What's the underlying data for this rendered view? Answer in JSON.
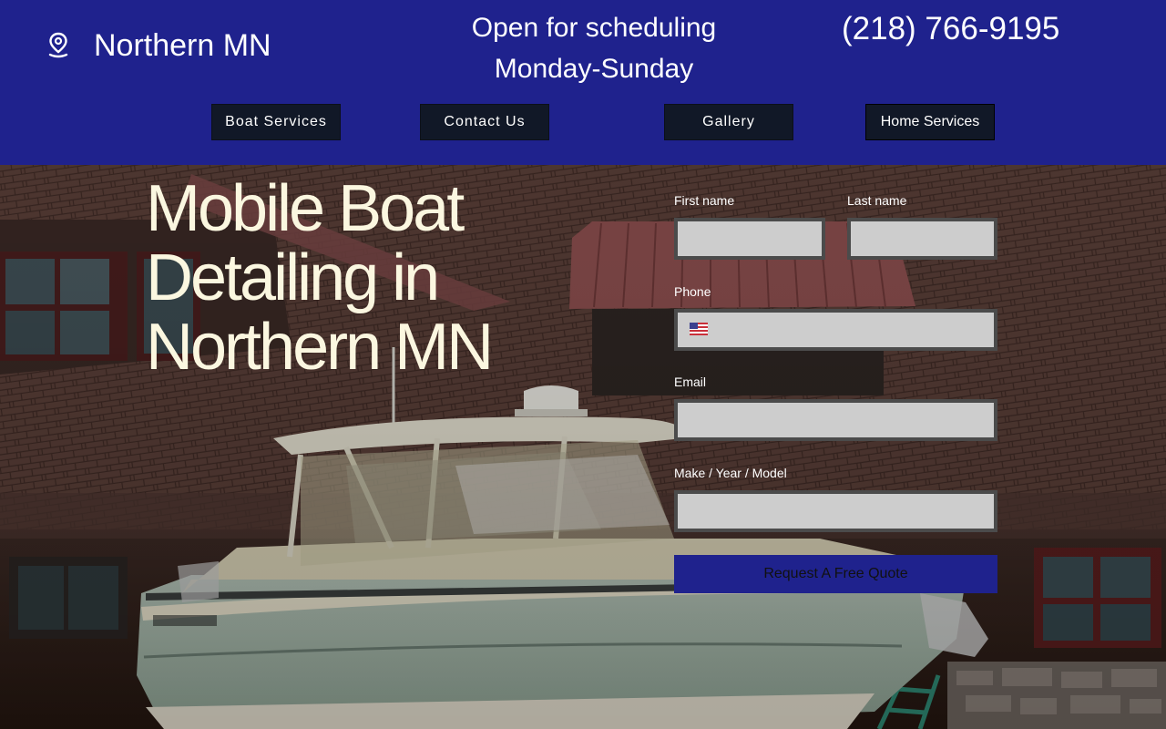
{
  "header": {
    "location": "Northern MN",
    "schedule_line1": "Open for scheduling",
    "schedule_line2": "Monday-Sunday",
    "phone": "(218) 766-9195",
    "location_icon": "map-pin-icon",
    "background_color": "#1f228d"
  },
  "nav": {
    "items": [
      {
        "label": "Boat Services"
      },
      {
        "label": "Contact Us"
      },
      {
        "label": "Gallery"
      },
      {
        "label": "Home Services"
      }
    ],
    "button_color": "#111827"
  },
  "hero": {
    "title": "Mobile Boat Detailing in Northern MN",
    "title_color": "#fbf7e0"
  },
  "form": {
    "first_name_label": "First name",
    "last_name_label": "Last name",
    "phone_label": "Phone",
    "email_label": "Email",
    "vehicle_label": "Make / Year / Model",
    "first_name_value": "",
    "last_name_value": "",
    "phone_value": "",
    "email_value": "",
    "vehicle_value": "",
    "phone_country_icon": "us-flag-icon",
    "submit_label": "Request A Free Quote",
    "field_color": "#cdcdcd",
    "submit_color": "#1f228d"
  }
}
